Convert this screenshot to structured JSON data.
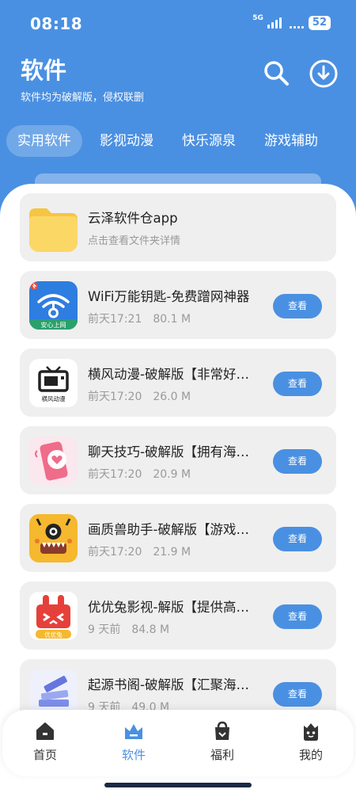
{
  "status": {
    "time": "08:18",
    "network": "5G",
    "battery": "52"
  },
  "header": {
    "title": "软件",
    "subtitle": "软件均为破解版，侵权联删"
  },
  "tabs": [
    {
      "label": "实用软件",
      "active": true
    },
    {
      "label": "影视动漫",
      "active": false
    },
    {
      "label": "快乐源泉",
      "active": false
    },
    {
      "label": "游戏辅助",
      "active": false
    }
  ],
  "folder": {
    "title": "云泽软件仓app",
    "subtitle": "点击查看文件夹详情",
    "icon": "folder-icon"
  },
  "apps": [
    {
      "title": "WiFi万能钥匙-免费蹭网神器",
      "time": "前天17:21",
      "size": "80.1 M",
      "button": "查看",
      "icon": "wifi-key-icon",
      "icon_text": "安心上网"
    },
    {
      "title": "横风动漫-破解版【非常好…",
      "time": "前天17:20",
      "size": "26.0 M",
      "button": "查看",
      "icon": "tv-icon",
      "icon_text": "横风动漫"
    },
    {
      "title": "聊天技巧-破解版【拥有海…",
      "time": "前天17:20",
      "size": "20.9 M",
      "button": "查看",
      "icon": "chat-phone-icon"
    },
    {
      "title": "画质兽助手-破解版【游戏…",
      "time": "前天17:20",
      "size": "21.9 M",
      "button": "查看",
      "icon": "monster-icon"
    },
    {
      "title": "优优兔影视-解版【提供高…",
      "time": "9 天前",
      "size": "84.8 M",
      "button": "查看",
      "icon": "rabbit-icon",
      "icon_text": "优优兔"
    },
    {
      "title": "起源书阁-破解版【汇聚海…",
      "time": "9 天前",
      "size": "49.0 M",
      "button": "查看",
      "icon": "books-icon"
    }
  ],
  "nav": [
    {
      "label": "首页",
      "icon": "home-icon",
      "active": false
    },
    {
      "label": "软件",
      "icon": "crown-icon",
      "active": true
    },
    {
      "label": "福利",
      "icon": "gift-bag-icon",
      "active": false
    },
    {
      "label": "我的",
      "icon": "profile-icon",
      "active": false
    }
  ],
  "colors": {
    "accent": "#4a90e2",
    "card": "#efefef",
    "text": "#222222",
    "muted": "#9a9a9a"
  }
}
